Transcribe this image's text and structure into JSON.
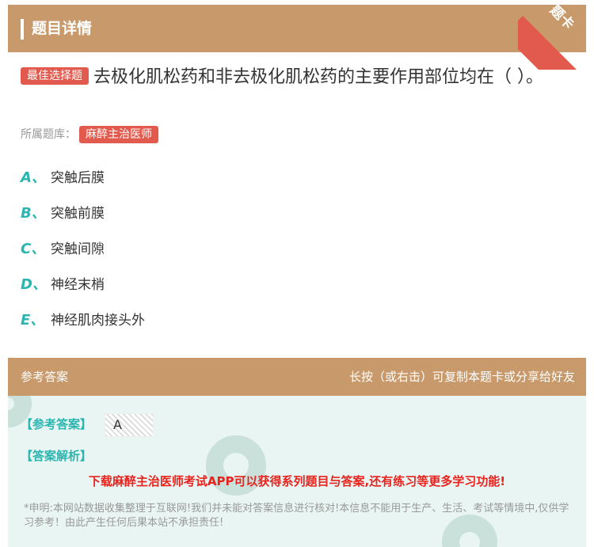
{
  "header": {
    "title": "题目详情",
    "corner_label": "题卡"
  },
  "question": {
    "badge": "最佳选择题",
    "text": "去极化肌松药和非去极化肌松药的主要作用部位均在（ ）。"
  },
  "bank": {
    "label": "所属题库：",
    "name": "麻醉主治医师"
  },
  "options": [
    {
      "letter": "A、",
      "text": "突触后膜"
    },
    {
      "letter": "B、",
      "text": "突触前膜"
    },
    {
      "letter": "C、",
      "text": "突触间隙"
    },
    {
      "letter": "D、",
      "text": "神经末梢"
    },
    {
      "letter": "E、",
      "text": "神经肌肉接头外"
    }
  ],
  "answer_section": {
    "title": "参考答案",
    "hint": "长按（或右击）可复制本题卡或分享给好友",
    "ref_label": "【参考答案】",
    "ref_value": "A",
    "analysis_label": "【答案解析】",
    "promo": "下载麻醉主治医师考试APP可以获得系列题目与答案,还有练习等更多学习功能!",
    "disclaimer": "*申明:本网站数据收集整理于互联网!我们并未能对答案信息进行核对!本信息不能用于生产、生活、考试等情境中,仅供学习参考！由此产生任何后果本站不承担责任!"
  },
  "colors": {
    "header_bg": "#c8996a",
    "accent_red": "#e25a4d",
    "accent_teal": "#2bb5b0",
    "answer_bg": "#e9f5f2",
    "promo_red": "#e8231e"
  }
}
